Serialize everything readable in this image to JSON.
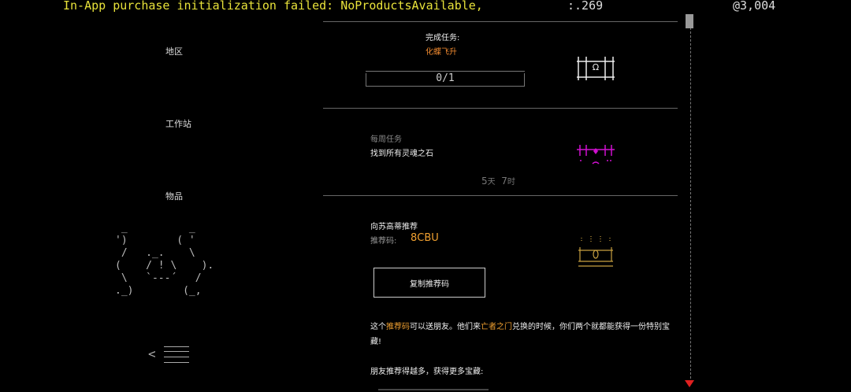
{
  "topbar": {
    "error_message": "In-App purchase initialization failed: NoProductsAvailable,",
    "ticker": ":.269",
    "currency": "@3,004"
  },
  "nav": {
    "items": [
      {
        "label": "地区"
      },
      {
        "label": "工作站"
      },
      {
        "label": "物品"
      }
    ],
    "back_glyph": "<"
  },
  "ascii_art": " _          _\n')        ( '\n /   ._.    \\\n(    / ! \\    ).\n \\   `---´   /\n._)        (_,",
  "task": {
    "label": "完成任务:",
    "name": "化蝶飞升",
    "progress_text": "0/1",
    "progress_value": 0
  },
  "weekly": {
    "label": "每周任务",
    "name": "找到所有灵魂之石",
    "days": "5",
    "days_unit": "天",
    "hours": "7",
    "hours_unit": "时"
  },
  "referral": {
    "title": "向苏高蒂推荐",
    "code_label": "推荐码:",
    "code": "8CBU",
    "copy_button": "复制推荐码",
    "desc_part1": "这个",
    "desc_hl1": "推荐码",
    "desc_part2": "可以送朋友。他们来",
    "desc_hl2": "亡者之门",
    "desc_part3": "兑换的时候，你们两个就都能获得一份特别宝藏!",
    "more": "朋友推荐得越多，获得更多宝藏:"
  },
  "colors": {
    "accent_orange": "#f0a030",
    "task_orange": "#f08a30",
    "error_yellow": "#e8e23a",
    "magenta": "#d010d0",
    "scroll_arrow_red": "#e02020"
  },
  "icons": [
    "chest-omega-icon",
    "soulstone-icon",
    "gold-chest-icon",
    "back-arrow-icon",
    "menu-lines-icon"
  ]
}
